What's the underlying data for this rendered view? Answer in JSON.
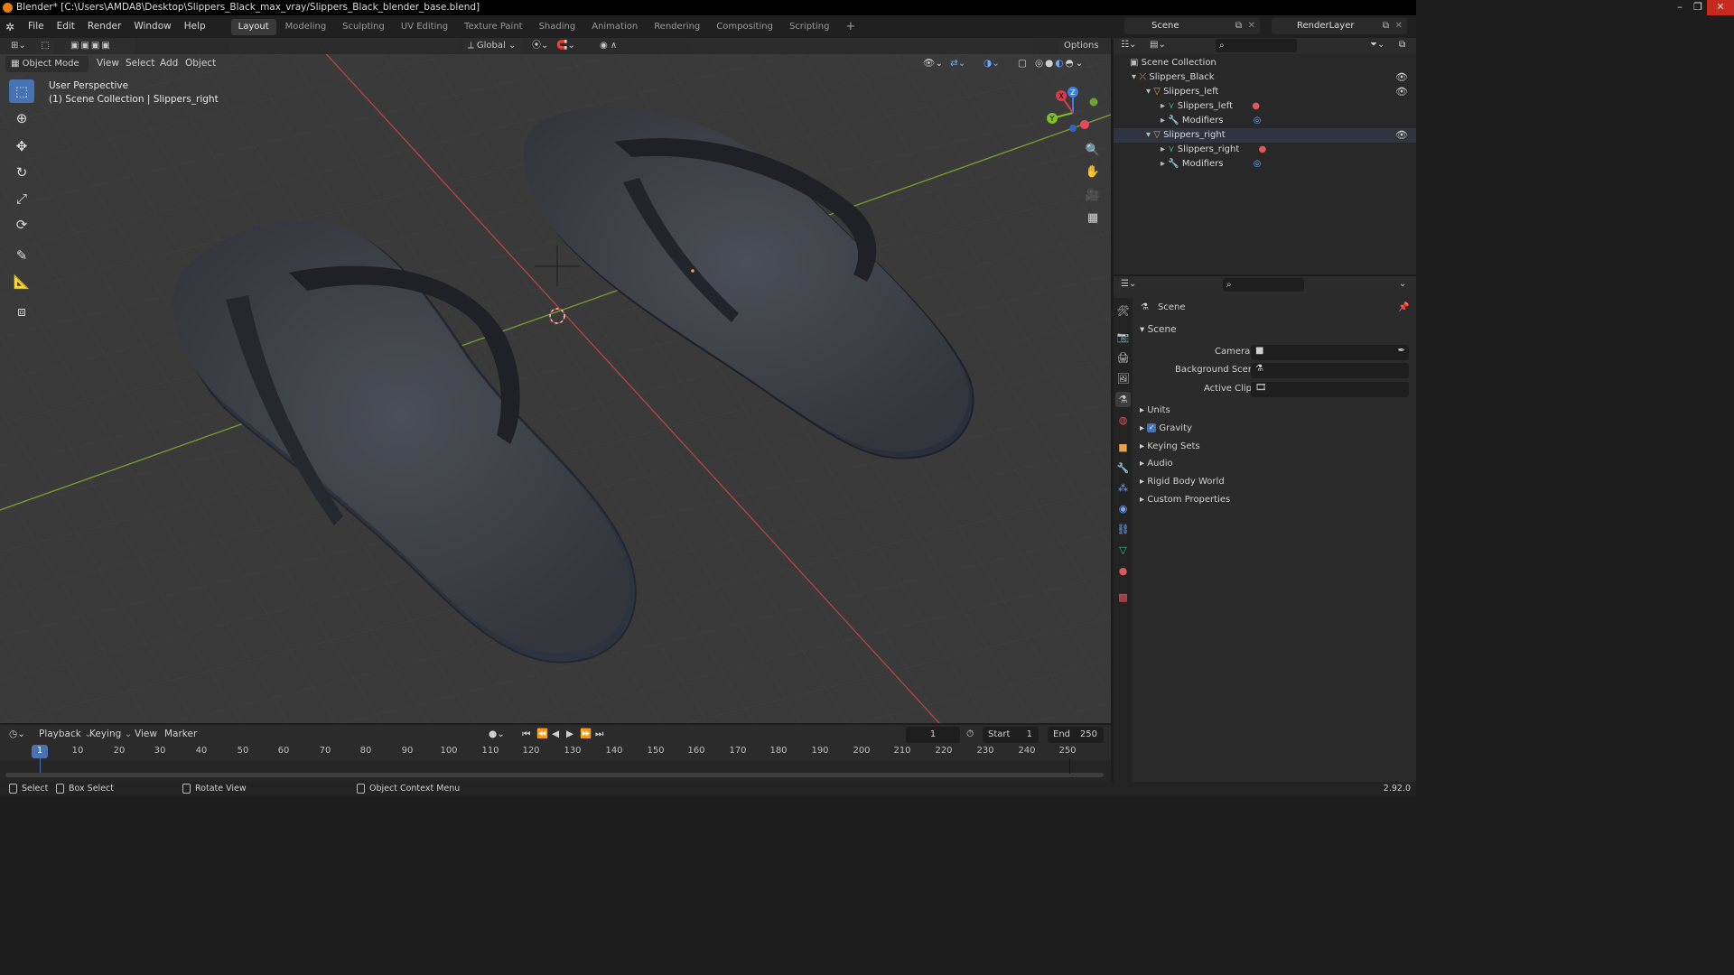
{
  "title_bar": {
    "title": "Blender* [C:\\Users\\AMDA8\\Desktop\\Slippers_Black_max_vray/Slippers_Black_blender_base.blend]"
  },
  "menus": [
    "File",
    "Edit",
    "Render",
    "Window",
    "Help"
  ],
  "workspaces": [
    "Layout",
    "Modeling",
    "Sculpting",
    "UV Editing",
    "Texture Paint",
    "Shading",
    "Animation",
    "Rendering",
    "Compositing",
    "Scripting"
  ],
  "scene_name": "Scene",
  "view_layer": "RenderLayer",
  "viewport": {
    "transform_orientation": "Global",
    "options_label": "Options",
    "mode": "Object Mode",
    "menus": [
      "View",
      "Select",
      "Add",
      "Object"
    ],
    "overlay_line1": "User Perspective",
    "overlay_line2": "(1) Scene Collection | Slippers_right",
    "axis_colors": {
      "x": "#d63d4c",
      "y": "#7ec225",
      "z": "#3d7fe0"
    }
  },
  "outliner": {
    "root": "Scene Collection",
    "items": [
      "Slippers_Black",
      "Slippers_left",
      "Slippers_left",
      "Modifiers",
      "Slippers_right",
      "Slippers_right",
      "Modifiers"
    ]
  },
  "properties": {
    "header": "Scene",
    "section": "Scene",
    "fields": [
      "Camera",
      "Background Scene",
      "Active Clip"
    ],
    "panels": [
      "Units",
      "Gravity",
      "Keying Sets",
      "Audio",
      "Rigid Body World",
      "Custom Properties"
    ]
  },
  "timeline": {
    "menus": [
      "Playback",
      "Keying",
      "View",
      "Marker"
    ],
    "current_frame": "1",
    "start_label": "Start",
    "start": "1",
    "end_label": "End",
    "end": "250",
    "ticks": [
      "1",
      "10",
      "20",
      "30",
      "40",
      "50",
      "60",
      "70",
      "80",
      "90",
      "100",
      "110",
      "120",
      "130",
      "140",
      "150",
      "160",
      "170",
      "180",
      "190",
      "200",
      "210",
      "220",
      "230",
      "240",
      "250"
    ]
  },
  "status_bar": {
    "select": "Select",
    "box_select": "Box Select",
    "rotate_view": "Rotate View",
    "context_menu": "Object Context Menu",
    "version": "2.92.0"
  }
}
